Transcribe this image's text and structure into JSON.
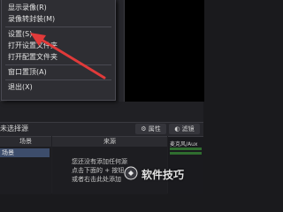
{
  "menu": {
    "items": [
      {
        "label": "显示录像(R)"
      },
      {
        "label": "录像转封装(M)"
      },
      {
        "label": "设置(S)"
      },
      {
        "label": "打开设置文件夹"
      },
      {
        "label": "打开配置文件夹"
      },
      {
        "label": "窗口置顶(A)"
      },
      {
        "label": "退出(X)"
      }
    ]
  },
  "status": {
    "no_source": "未选择源",
    "properties": "属性",
    "filters": "滤镜"
  },
  "panels": {
    "scenes_header": "场景",
    "sources_header": "来源",
    "scene_item": "场景",
    "hint_line1": "您还没有添加任何源",
    "hint_line2": "点击下面的 + 按钮",
    "hint_line3": "或者右击此处添加"
  },
  "mixer": {
    "label": "麦克风/Aux"
  },
  "watermark": {
    "text": "软件技巧"
  },
  "colors": {
    "arrow": "#e03a3a",
    "accent": "#3d4d6b"
  }
}
